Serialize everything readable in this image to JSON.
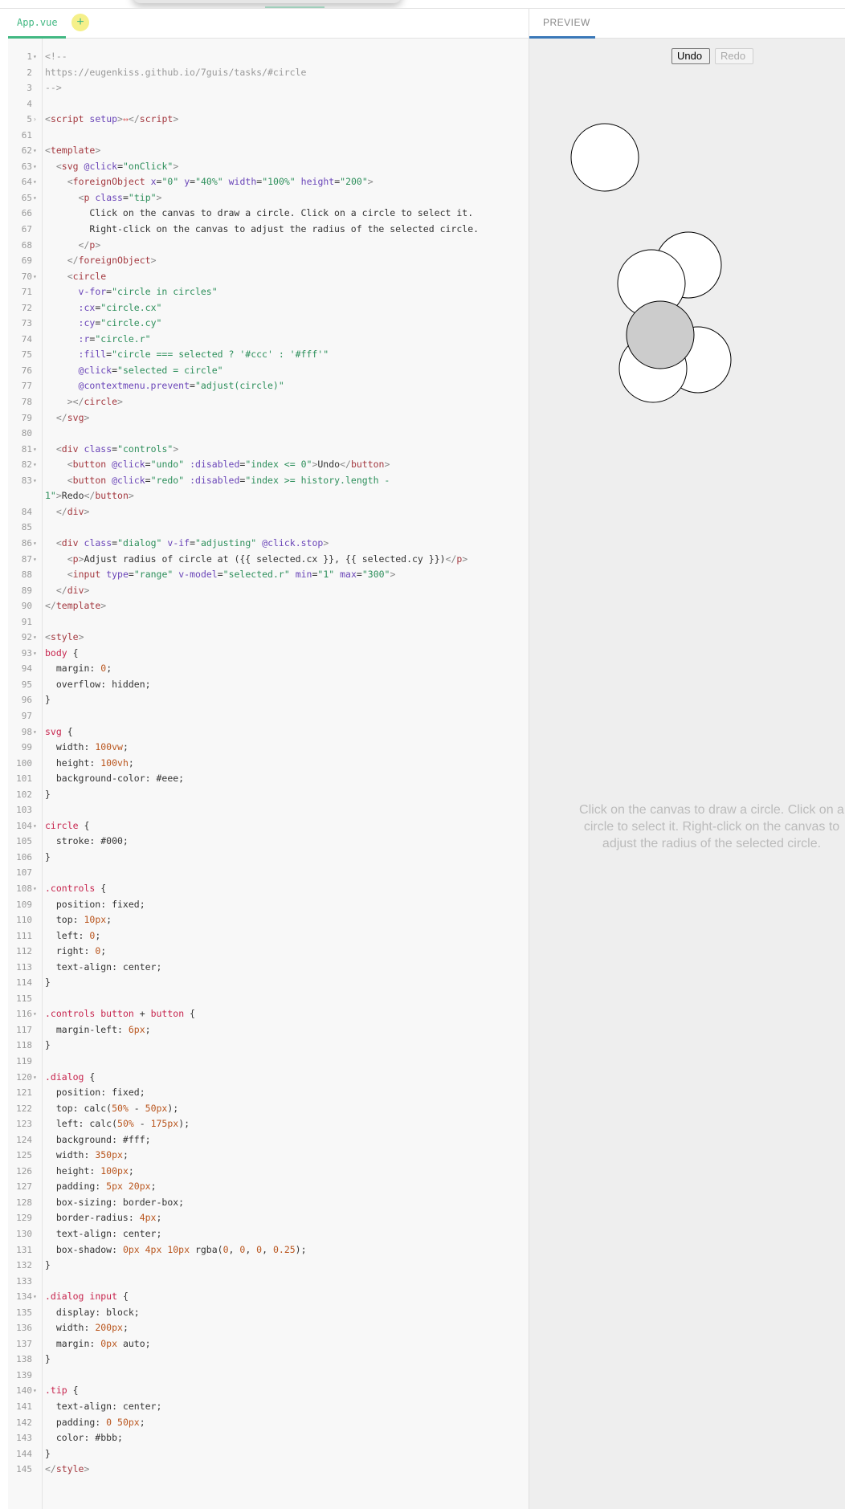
{
  "editor": {
    "file_tab": "App.vue",
    "add_tab_label": "+",
    "lines": [
      {
        "n": "1",
        "fold": true,
        "html": "<span class='c-com'>&lt;!--</span>"
      },
      {
        "n": "2",
        "fold": false,
        "html": "<span class='c-com'>https://eugenkiss.github.io/7guis/tasks/#circle</span>"
      },
      {
        "n": "3",
        "fold": false,
        "html": "<span class='c-com'>--&gt;</span>"
      },
      {
        "n": "4",
        "fold": false,
        "html": ""
      },
      {
        "n": "5",
        "fold": true,
        "foldclosed": true,
        "html": "<span class='c-punct'>&lt;</span><span class='c-tag'>script</span> <span class='c-attr'>setup</span><span class='c-punct'>&gt;</span><span style='color:#d66'>↔</span><span class='c-punct'>&lt;/</span><span class='c-tag'>script</span><span class='c-punct'>&gt;</span>"
      },
      {
        "n": "61",
        "fold": false,
        "html": ""
      },
      {
        "n": "62",
        "fold": true,
        "html": "<span class='c-punct'>&lt;</span><span class='c-tag'>template</span><span class='c-punct'>&gt;</span>"
      },
      {
        "n": "63",
        "fold": true,
        "html": "  <span class='c-punct'>&lt;</span><span class='c-tag'>svg</span> <span class='c-attr'>@click</span>=<span class='c-str'>\"onClick\"</span><span class='c-punct'>&gt;</span>"
      },
      {
        "n": "64",
        "fold": true,
        "html": "    <span class='c-punct'>&lt;</span><span class='c-tag'>foreignObject</span> <span class='c-attr'>x</span>=<span class='c-str'>\"0\"</span> <span class='c-attr'>y</span>=<span class='c-str'>\"40%\"</span> <span class='c-attr'>width</span>=<span class='c-str'>\"100%\"</span> <span class='c-attr'>height</span>=<span class='c-str'>\"200\"</span><span class='c-punct'>&gt;</span>"
      },
      {
        "n": "65",
        "fold": true,
        "html": "      <span class='c-punct'>&lt;</span><span class='c-tag'>p</span> <span class='c-attr'>class</span>=<span class='c-str'>\"tip\"</span><span class='c-punct'>&gt;</span>"
      },
      {
        "n": "66",
        "fold": false,
        "html": "        Click on the canvas to draw a circle. Click on a circle to select it."
      },
      {
        "n": "67",
        "fold": false,
        "html": "        Right-click on the canvas to adjust the radius of the selected circle."
      },
      {
        "n": "68",
        "fold": false,
        "html": "      <span class='c-punct'>&lt;/</span><span class='c-tag'>p</span><span class='c-punct'>&gt;</span>"
      },
      {
        "n": "69",
        "fold": false,
        "html": "    <span class='c-punct'>&lt;/</span><span class='c-tag'>foreignObject</span><span class='c-punct'>&gt;</span>"
      },
      {
        "n": "70",
        "fold": true,
        "html": "    <span class='c-punct'>&lt;</span><span class='c-tag'>circle</span>"
      },
      {
        "n": "71",
        "fold": false,
        "html": "      <span class='c-attr'>v-for</span>=<span class='c-str'>\"circle in circles\"</span>"
      },
      {
        "n": "72",
        "fold": false,
        "html": "      <span class='c-attr'>:cx</span>=<span class='c-str'>\"circle.cx\"</span>"
      },
      {
        "n": "73",
        "fold": false,
        "html": "      <span class='c-attr'>:cy</span>=<span class='c-str'>\"circle.cy\"</span>"
      },
      {
        "n": "74",
        "fold": false,
        "html": "      <span class='c-attr'>:r</span>=<span class='c-str'>\"circle.r\"</span>"
      },
      {
        "n": "75",
        "fold": false,
        "html": "      <span class='c-attr'>:fill</span>=<span class='c-str'>\"circle === selected ? '#ccc' : '#fff'\"</span>"
      },
      {
        "n": "76",
        "fold": false,
        "html": "      <span class='c-attr'>@click</span>=<span class='c-str'>\"selected = circle\"</span>"
      },
      {
        "n": "77",
        "fold": false,
        "html": "      <span class='c-attr'>@contextmenu.prevent</span>=<span class='c-str'>\"adjust(circle)\"</span>"
      },
      {
        "n": "78",
        "fold": false,
        "html": "    <span class='c-punct'>&gt;&lt;/</span><span class='c-tag'>circle</span><span class='c-punct'>&gt;</span>"
      },
      {
        "n": "79",
        "fold": false,
        "html": "  <span class='c-punct'>&lt;/</span><span class='c-tag'>svg</span><span class='c-punct'>&gt;</span>"
      },
      {
        "n": "80",
        "fold": false,
        "html": ""
      },
      {
        "n": "81",
        "fold": true,
        "html": "  <span class='c-punct'>&lt;</span><span class='c-tag'>div</span> <span class='c-attr'>class</span>=<span class='c-str'>\"controls\"</span><span class='c-punct'>&gt;</span>"
      },
      {
        "n": "82",
        "fold": true,
        "html": "    <span class='c-punct'>&lt;</span><span class='c-tag'>button</span> <span class='c-attr'>@click</span>=<span class='c-str'>\"undo\"</span> <span class='c-attr'>:disabled</span>=<span class='c-str'>\"index &lt;= 0\"</span><span class='c-punct'>&gt;</span>Undo<span class='c-punct'>&lt;/</span><span class='c-tag'>button</span><span class='c-punct'>&gt;</span>"
      },
      {
        "n": "83",
        "fold": true,
        "html": "    <span class='c-punct'>&lt;</span><span class='c-tag'>button</span> <span class='c-attr'>@click</span>=<span class='c-str'>\"redo\"</span> <span class='c-attr'>:disabled</span>=<span class='c-str'>\"index &gt;= history.length -</span>"
      },
      {
        "n": "",
        "fold": false,
        "html": "<span class='c-str'>1\"</span><span class='c-punct'>&gt;</span>Redo<span class='c-punct'>&lt;/</span><span class='c-tag'>button</span><span class='c-punct'>&gt;</span>"
      },
      {
        "n": "84",
        "fold": false,
        "html": "  <span class='c-punct'>&lt;/</span><span class='c-tag'>div</span><span class='c-punct'>&gt;</span>"
      },
      {
        "n": "85",
        "fold": false,
        "html": ""
      },
      {
        "n": "86",
        "fold": true,
        "html": "  <span class='c-punct'>&lt;</span><span class='c-tag'>div</span> <span class='c-attr'>class</span>=<span class='c-str'>\"dialog\"</span> <span class='c-attr'>v-if</span>=<span class='c-str'>\"adjusting\"</span> <span class='c-attr'>@click.stop</span><span class='c-punct'>&gt;</span>"
      },
      {
        "n": "87",
        "fold": true,
        "html": "    <span class='c-punct'>&lt;</span><span class='c-tag'>p</span><span class='c-punct'>&gt;</span>Adjust radius of circle at ({{ selected.cx }}, {{ selected.cy }})<span class='c-punct'>&lt;/</span><span class='c-tag'>p</span><span class='c-punct'>&gt;</span>"
      },
      {
        "n": "88",
        "fold": false,
        "html": "    <span class='c-punct'>&lt;</span><span class='c-tag'>input</span> <span class='c-attr'>type</span>=<span class='c-str'>\"range\"</span> <span class='c-attr'>v-model</span>=<span class='c-str'>\"selected.r\"</span> <span class='c-attr'>min</span>=<span class='c-str'>\"1\"</span> <span class='c-attr'>max</span>=<span class='c-str'>\"300\"</span><span class='c-punct'>&gt;</span>"
      },
      {
        "n": "89",
        "fold": false,
        "html": "  <span class='c-punct'>&lt;/</span><span class='c-tag'>div</span><span class='c-punct'>&gt;</span>"
      },
      {
        "n": "90",
        "fold": false,
        "html": "<span class='c-punct'>&lt;/</span><span class='c-tag'>template</span><span class='c-punct'>&gt;</span>"
      },
      {
        "n": "91",
        "fold": false,
        "html": ""
      },
      {
        "n": "92",
        "fold": true,
        "html": "<span class='c-punct'>&lt;</span><span class='c-tag'>style</span><span class='c-punct'>&gt;</span>"
      },
      {
        "n": "93",
        "fold": true,
        "html": "<span class='c-sel'>body</span> {"
      },
      {
        "n": "94",
        "fold": false,
        "html": "  margin: <span class='c-num'>0</span>;"
      },
      {
        "n": "95",
        "fold": false,
        "html": "  overflow: hidden;"
      },
      {
        "n": "96",
        "fold": false,
        "html": "}"
      },
      {
        "n": "97",
        "fold": false,
        "html": ""
      },
      {
        "n": "98",
        "fold": true,
        "html": "<span class='c-sel'>svg</span> {"
      },
      {
        "n": "99",
        "fold": false,
        "html": "  width: <span class='c-num'>100vw</span>;"
      },
      {
        "n": "100",
        "fold": false,
        "html": "  height: <span class='c-num'>100vh</span>;"
      },
      {
        "n": "101",
        "fold": false,
        "html": "  background-color: #eee;"
      },
      {
        "n": "102",
        "fold": false,
        "html": "}"
      },
      {
        "n": "103",
        "fold": false,
        "html": ""
      },
      {
        "n": "104",
        "fold": true,
        "html": "<span class='c-sel'>circle</span> {"
      },
      {
        "n": "105",
        "fold": false,
        "html": "  stroke: #000;"
      },
      {
        "n": "106",
        "fold": false,
        "html": "}"
      },
      {
        "n": "107",
        "fold": false,
        "html": ""
      },
      {
        "n": "108",
        "fold": true,
        "html": "<span class='c-sel'>.controls</span> {"
      },
      {
        "n": "109",
        "fold": false,
        "html": "  position: fixed;"
      },
      {
        "n": "110",
        "fold": false,
        "html": "  top: <span class='c-num'>10px</span>;"
      },
      {
        "n": "111",
        "fold": false,
        "html": "  left: <span class='c-num'>0</span>;"
      },
      {
        "n": "112",
        "fold": false,
        "html": "  right: <span class='c-num'>0</span>;"
      },
      {
        "n": "113",
        "fold": false,
        "html": "  text-align: center;"
      },
      {
        "n": "114",
        "fold": false,
        "html": "}"
      },
      {
        "n": "115",
        "fold": false,
        "html": ""
      },
      {
        "n": "116",
        "fold": true,
        "html": "<span class='c-sel'>.controls</span> <span class='c-sel'>button</span> + <span class='c-sel'>button</span> {"
      },
      {
        "n": "117",
        "fold": false,
        "html": "  margin-left: <span class='c-num'>6px</span>;"
      },
      {
        "n": "118",
        "fold": false,
        "html": "}"
      },
      {
        "n": "119",
        "fold": false,
        "html": ""
      },
      {
        "n": "120",
        "fold": true,
        "html": "<span class='c-sel'>.dialog</span> {"
      },
      {
        "n": "121",
        "fold": false,
        "html": "  position: fixed;"
      },
      {
        "n": "122",
        "fold": false,
        "html": "  top: calc(<span class='c-num'>50%</span> - <span class='c-num'>50px</span>);"
      },
      {
        "n": "123",
        "fold": false,
        "html": "  left: calc(<span class='c-num'>50%</span> - <span class='c-num'>175px</span>);"
      },
      {
        "n": "124",
        "fold": false,
        "html": "  background: #fff;"
      },
      {
        "n": "125",
        "fold": false,
        "html": "  width: <span class='c-num'>350px</span>;"
      },
      {
        "n": "126",
        "fold": false,
        "html": "  height: <span class='c-num'>100px</span>;"
      },
      {
        "n": "127",
        "fold": false,
        "html": "  padding: <span class='c-num'>5px 20px</span>;"
      },
      {
        "n": "128",
        "fold": false,
        "html": "  box-sizing: border-box;"
      },
      {
        "n": "129",
        "fold": false,
        "html": "  border-radius: <span class='c-num'>4px</span>;"
      },
      {
        "n": "130",
        "fold": false,
        "html": "  text-align: center;"
      },
      {
        "n": "131",
        "fold": false,
        "html": "  box-shadow: <span class='c-num'>0px 4px 10px</span> rgba(<span class='c-num'>0</span>, <span class='c-num'>0</span>, <span class='c-num'>0</span>, <span class='c-num'>0.25</span>);"
      },
      {
        "n": "132",
        "fold": false,
        "html": "}"
      },
      {
        "n": "133",
        "fold": false,
        "html": ""
      },
      {
        "n": "134",
        "fold": true,
        "html": "<span class='c-sel'>.dialog</span> <span class='c-sel'>input</span> {"
      },
      {
        "n": "135",
        "fold": false,
        "html": "  display: block;"
      },
      {
        "n": "136",
        "fold": false,
        "html": "  width: <span class='c-num'>200px</span>;"
      },
      {
        "n": "137",
        "fold": false,
        "html": "  margin: <span class='c-num'>0px</span> auto;"
      },
      {
        "n": "138",
        "fold": false,
        "html": "}"
      },
      {
        "n": "139",
        "fold": false,
        "html": ""
      },
      {
        "n": "140",
        "fold": true,
        "html": "<span class='c-sel'>.tip</span> {"
      },
      {
        "n": "141",
        "fold": false,
        "html": "  text-align: center;"
      },
      {
        "n": "142",
        "fold": false,
        "html": "  padding: <span class='c-num'>0 50px</span>;"
      },
      {
        "n": "143",
        "fold": false,
        "html": "  color: #bbb;"
      },
      {
        "n": "144",
        "fold": false,
        "html": "}"
      },
      {
        "n": "145",
        "fold": false,
        "html": "<span class='c-punct'>&lt;/</span><span class='c-tag'>style</span><span class='c-punct'>&gt;</span>"
      }
    ]
  },
  "preview": {
    "tab_label": "PREVIEW",
    "undo_label": "Undo",
    "redo_label": "Redo",
    "tip": "Click on the canvas to draw a circle. Click on a circle to select it. Right-click on the canvas to adjust the radius of the selected circle.",
    "colors": {
      "background": "#eeeeee",
      "circle_fill": "#ffffff",
      "selected_fill": "#cccccc",
      "stroke": "#000000"
    },
    "circles": [
      {
        "selected": false
      },
      {
        "selected": false
      },
      {
        "selected": false
      },
      {
        "selected": false
      },
      {
        "selected": false
      },
      {
        "selected": true
      }
    ]
  }
}
